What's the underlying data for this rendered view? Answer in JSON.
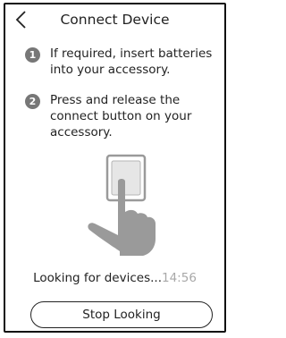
{
  "header": {
    "title": "Connect Device",
    "back_icon": "chevron-left-icon"
  },
  "steps": [
    {
      "number": "1",
      "text": "If required, insert batteries into your accessory."
    },
    {
      "number": "2",
      "text": "Press and release the connect button on your accessory."
    }
  ],
  "illustration": {
    "icon": "hand-pressing-button-icon"
  },
  "status": {
    "label": "Looking for devices...",
    "timer": "14:56"
  },
  "actions": {
    "stop_label": "Stop Looking"
  },
  "colors": {
    "step_badge": "#777777",
    "timer": "#a8a8a8",
    "illustration": "#9a9a9a",
    "button_face": "#e6e6e6"
  }
}
